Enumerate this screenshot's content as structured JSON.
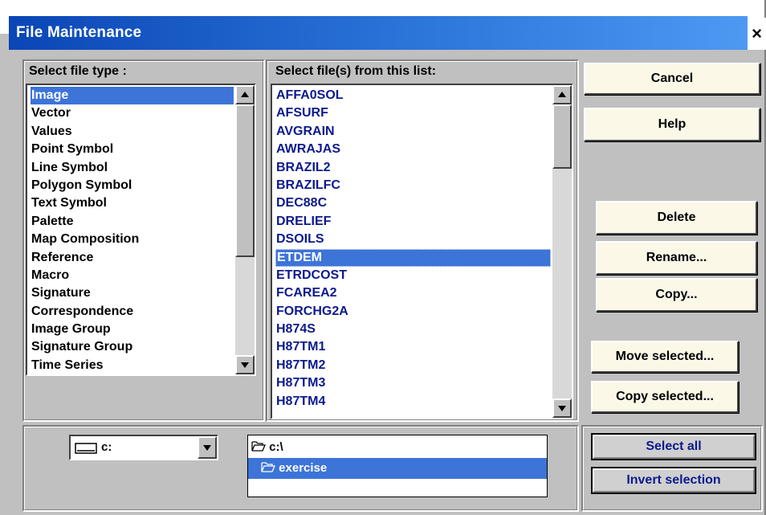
{
  "window": {
    "title": "File Maintenance",
    "close_glyph": "×"
  },
  "file_type": {
    "label": "Select file type :",
    "items": [
      "Image",
      "Vector",
      "Values",
      "Point Symbol",
      "Line Symbol",
      "Polygon Symbol",
      "Text Symbol",
      "Palette",
      "Map Composition",
      "Reference",
      "Macro",
      "Signature",
      "Correspondence",
      "Image Group",
      "Signature Group",
      "Time Series"
    ],
    "selected_index": 0
  },
  "files": {
    "label": "Select file(s) from this list:",
    "items": [
      "AFFA0SOL",
      "AFSURF",
      "AVGRAIN",
      "AWRAJAS",
      "BRAZIL2",
      "BRAZILFC",
      "DEC88C",
      "DRELIEF",
      "DSOILS",
      "ETDEM",
      "ETRDCOST",
      "FCAREA2",
      "FORCHG2A",
      "H874S",
      "H87TM1",
      "H87TM2",
      "H87TM3",
      "H87TM4"
    ],
    "selected_index": 9
  },
  "buttons": {
    "cancel": "Cancel",
    "help": "Help",
    "delete": "Delete",
    "rename": "Rename...",
    "copy": "Copy...",
    "move_selected": "Move selected...",
    "copy_selected": "Copy selected...",
    "select_all": "Select all",
    "invert_selection": "Invert selection"
  },
  "drive": {
    "value": "c:"
  },
  "directories": [
    {
      "name": "c:\\",
      "icon": "open-folder-icon"
    },
    {
      "name": "exercise",
      "icon": "open-folder-icon",
      "selected": true
    }
  ],
  "colors": {
    "title_start": "#0a46b6",
    "title_end": "#4d99f2",
    "selection": "#3d74d8",
    "file_text": "#0c1a8c",
    "button_face": "#fbf8e8"
  }
}
